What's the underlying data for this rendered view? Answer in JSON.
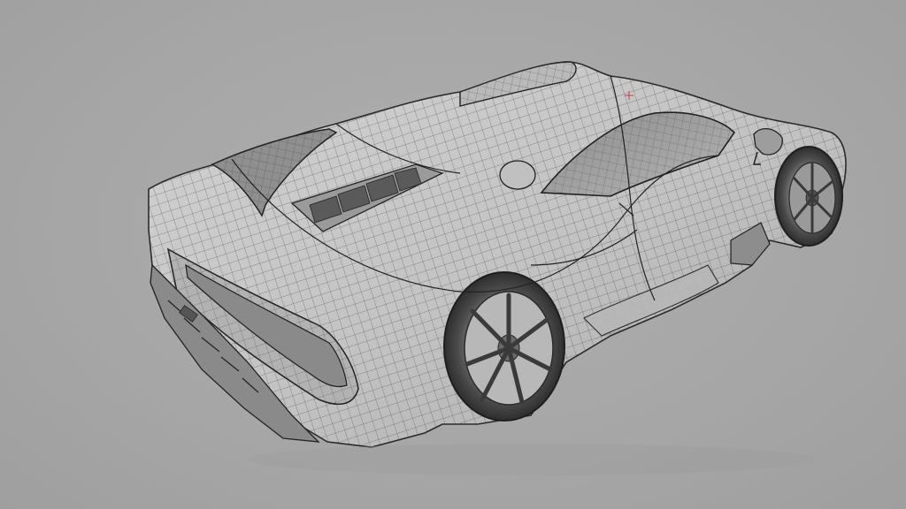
{
  "scene": {
    "subject": "car-wireframe-model",
    "colors": {
      "background": "#a8a8a8",
      "body_fill": "#c9c9c9",
      "body_shadow": "#8e8e8e",
      "wire": "#2b2b2b",
      "tire": "#3a3a3a",
      "rim": "#7a7a7a",
      "pivot_marker": "#d23a3a"
    }
  }
}
